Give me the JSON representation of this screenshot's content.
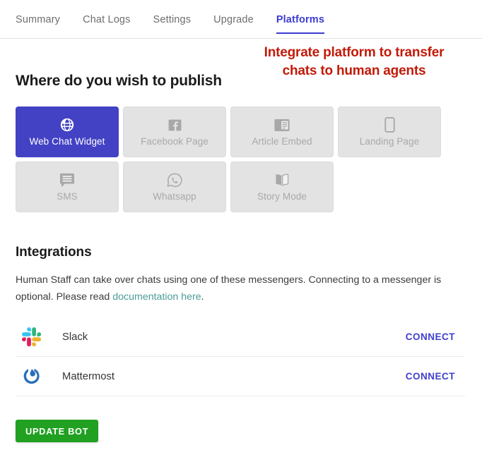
{
  "tabs": [
    {
      "label": "Summary",
      "active": false
    },
    {
      "label": "Chat Logs",
      "active": false
    },
    {
      "label": "Settings",
      "active": false
    },
    {
      "label": "Upgrade",
      "active": false
    },
    {
      "label": "Platforms",
      "active": true
    }
  ],
  "annotation": {
    "line1": "Integrate platform to transfer",
    "line2": "chats to human agents",
    "color": "#c21a08"
  },
  "publish": {
    "heading": "Where do you wish to publish",
    "tiles": [
      {
        "label": "Web Chat Widget",
        "icon": "globe-icon",
        "selected": true
      },
      {
        "label": "Facebook Page",
        "icon": "facebook-icon",
        "selected": false
      },
      {
        "label": "Article Embed",
        "icon": "article-icon",
        "selected": false
      },
      {
        "label": "Landing Page",
        "icon": "mobile-icon",
        "selected": false
      },
      {
        "label": "SMS",
        "icon": "message-icon",
        "selected": false
      },
      {
        "label": "Whatsapp",
        "icon": "whatsapp-icon",
        "selected": false
      },
      {
        "label": "Story Mode",
        "icon": "book-icon",
        "selected": false
      }
    ],
    "selected_color": "#4342c4",
    "tile_color": "#e3e3e3"
  },
  "integrations": {
    "heading": "Integrations",
    "description_part1": "Human Staff can take over chats using one of these messengers. Connecting to a messenger is optional. Please read ",
    "link_text": "documentation here",
    "description_part2": ".",
    "link_color": "#4a9d98",
    "connect_label": "CONNECT",
    "items": [
      {
        "name": "Slack",
        "icon": "slack-icon",
        "action": "CONNECT"
      },
      {
        "name": "Mattermost",
        "icon": "mattermost-icon",
        "action": "CONNECT"
      }
    ]
  },
  "footer": {
    "update_label": "UPDATE BOT",
    "update_color": "#21a021"
  }
}
